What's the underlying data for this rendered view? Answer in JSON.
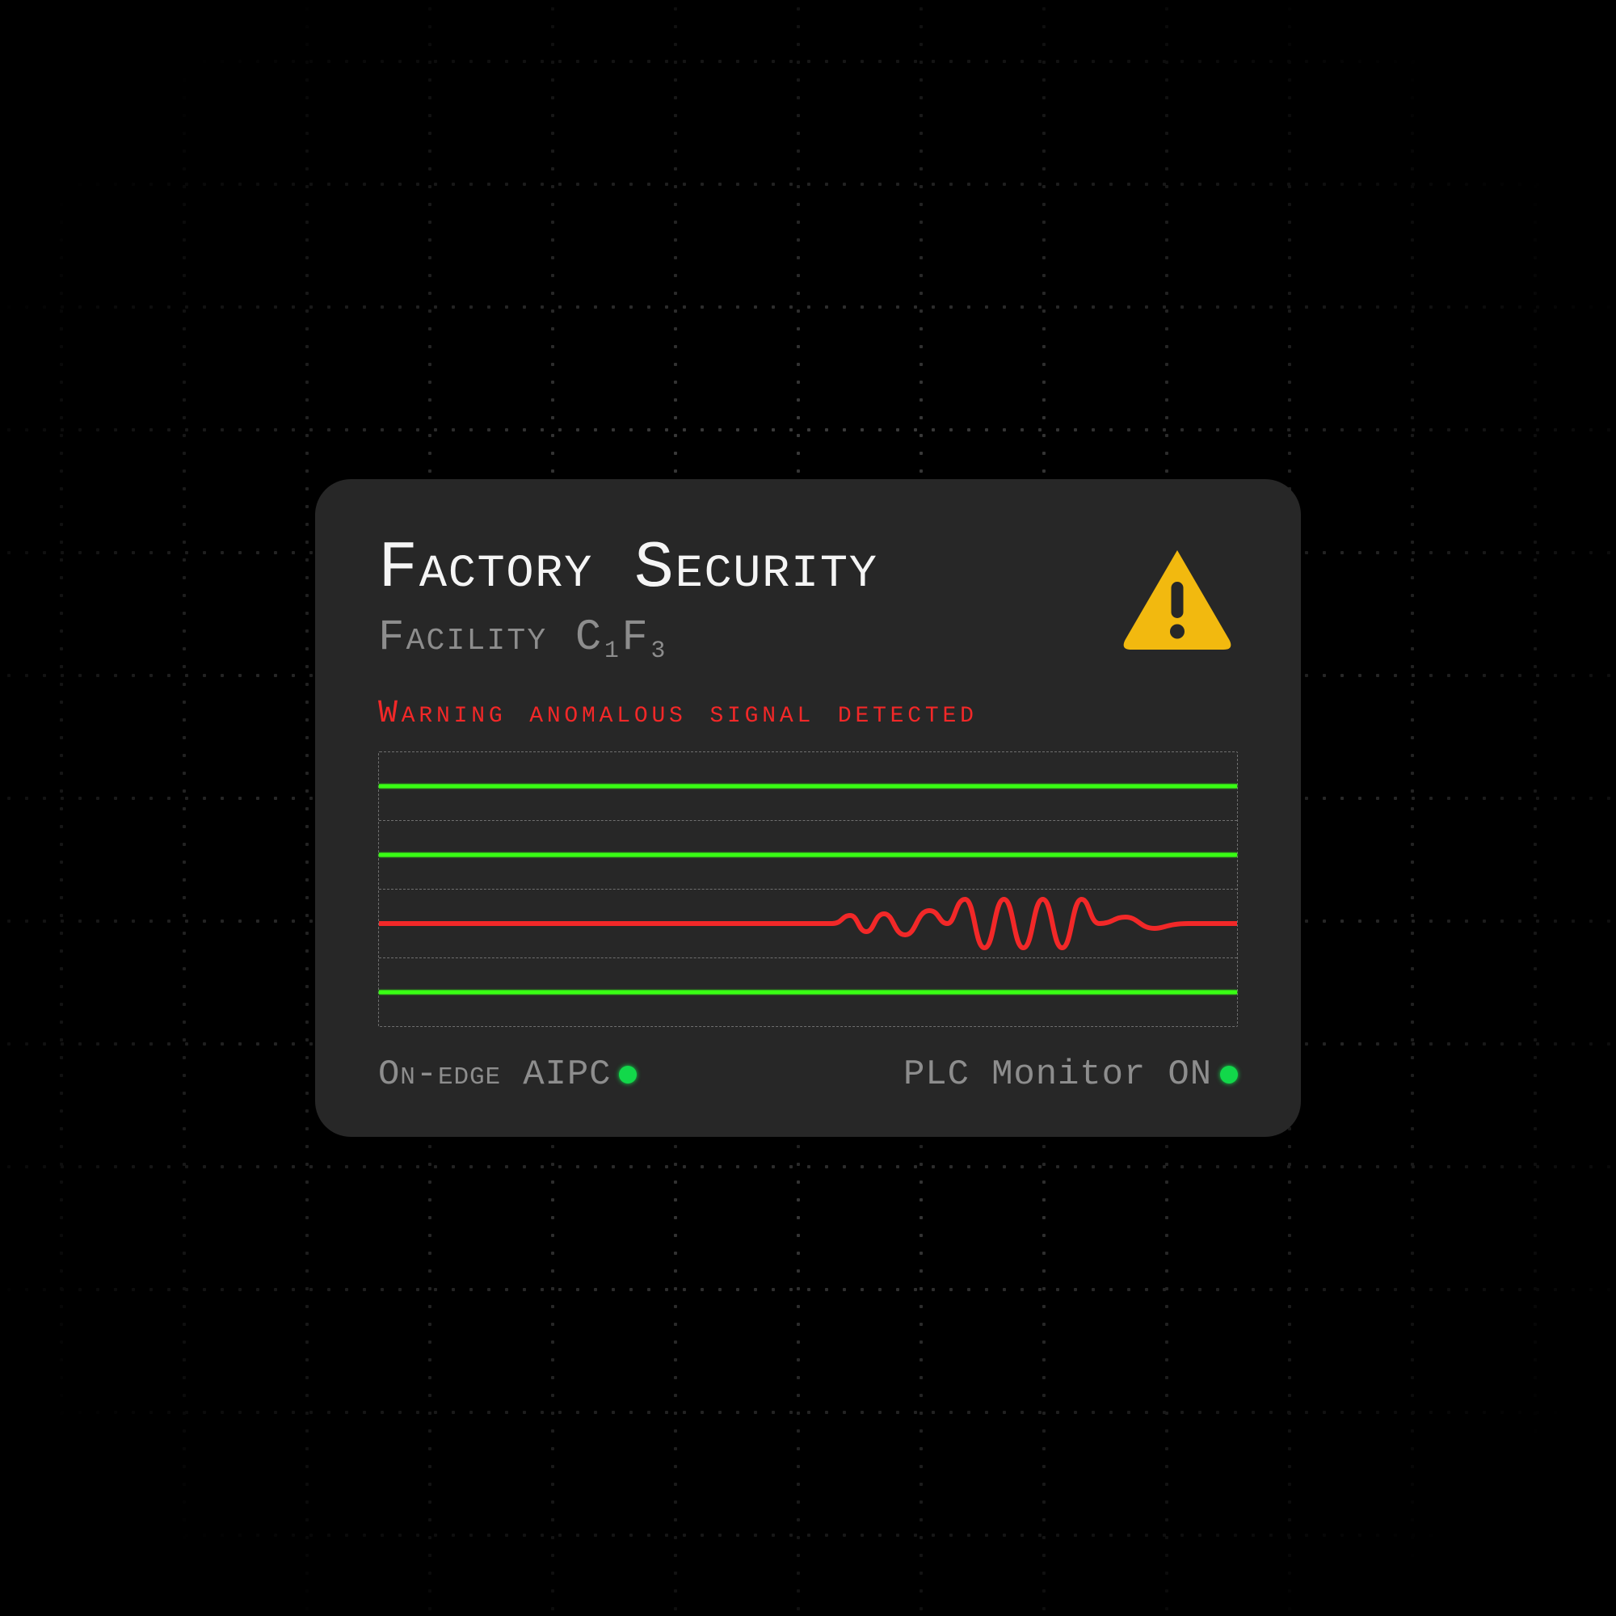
{
  "card": {
    "title": "Factory Security",
    "facility_label_html": "Facility C<sub>1</sub>F<sub>3</sub>",
    "warning_text": "Warning anomalous signal detected",
    "warning_icon": "warning-triangle-icon"
  },
  "colors": {
    "normal_signal": "#39ff14",
    "anomaly_signal": "#f22828",
    "status_dot": "#12d84a",
    "warning_icon": "#f2b90f",
    "card_bg": "#272727"
  },
  "signals": [
    {
      "id": "ch1",
      "status": "normal"
    },
    {
      "id": "ch2",
      "status": "normal"
    },
    {
      "id": "ch3",
      "status": "anomaly"
    },
    {
      "id": "ch4",
      "status": "normal"
    }
  ],
  "status": {
    "left_label": "On-edge AIPC",
    "left_state": "on",
    "right_label": "PLC Monitor ON",
    "right_state": "on"
  }
}
